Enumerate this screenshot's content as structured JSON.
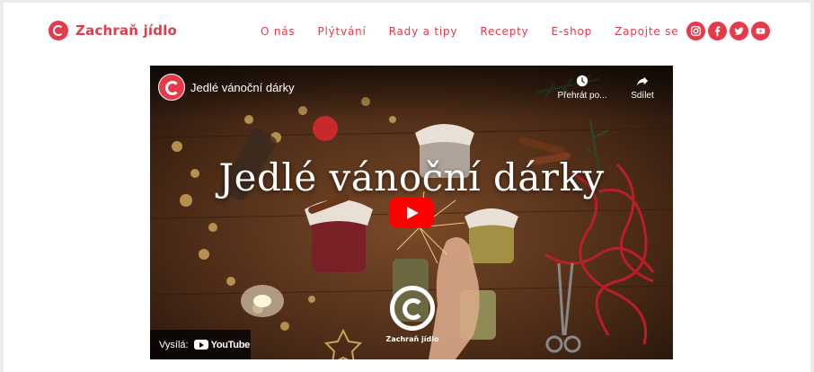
{
  "header": {
    "logo_text": "Zachraň jídlo",
    "nav": [
      {
        "label": "O nás"
      },
      {
        "label": "Plýtvání"
      },
      {
        "label": "Rady a tipy"
      },
      {
        "label": "Recepty"
      },
      {
        "label": "E-shop"
      },
      {
        "label": "Zapojte se"
      }
    ],
    "social_icons": [
      "instagram-icon",
      "facebook-icon",
      "twitter-icon",
      "youtube-icon"
    ]
  },
  "video": {
    "title": "Jedlé vánoční dárky",
    "overlay_title": "Jedlé vánoční dárky",
    "watch_later_label": "Přehrát po...",
    "share_label": "Sdílet",
    "brand_text": "Zachraň jídlo",
    "watch_on_label": "Vysílá:",
    "youtube_label": "YouTube"
  },
  "colors": {
    "brand_red": "#e43a4a",
    "youtube_red": "#ff0000"
  }
}
